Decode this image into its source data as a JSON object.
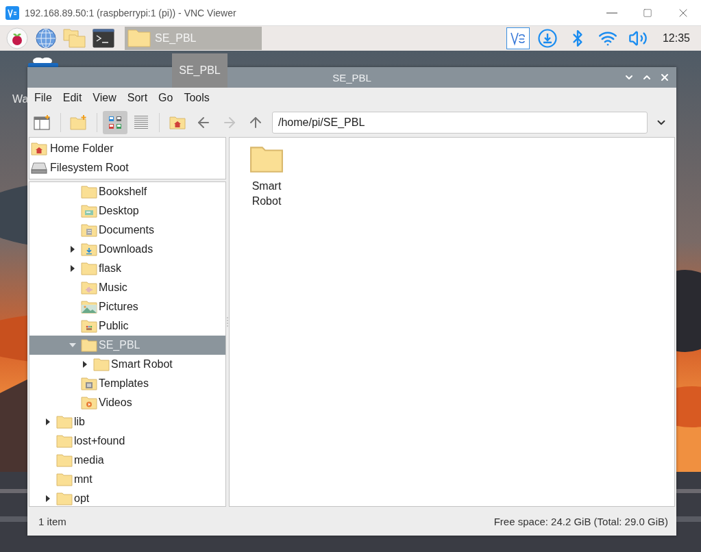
{
  "viewer_window": {
    "title": "192.168.89.50:1 (raspberrypi:1 (pi)) - VNC Viewer"
  },
  "taskbar": {
    "task_button": {
      "label": "SE_PBL"
    },
    "clock": "12:35"
  },
  "desktop": {
    "icon_label": "Wa",
    "tooltip": "SE_PBL"
  },
  "file_manager": {
    "title": "SE_PBL",
    "menu": [
      "File",
      "Edit",
      "View",
      "Sort",
      "Go",
      "Tools"
    ],
    "view_modes": [
      {
        "kind": "icons",
        "selected": true
      },
      {
        "kind": "list",
        "selected": false
      }
    ],
    "nav": [
      {
        "kind": "back",
        "disabled": false
      },
      {
        "kind": "forward",
        "disabled": true
      },
      {
        "kind": "up",
        "disabled": false
      }
    ],
    "path": "/home/pi/SE_PBL",
    "places": [
      {
        "kind": "home",
        "label": "Home Folder"
      },
      {
        "kind": "drive",
        "label": "Filesystem Root"
      }
    ],
    "tree": [
      {
        "children": [
          {
            "children": [
              {
                "label": "Bookshelf",
                "selected": false
              },
              {
                "label": "Desktop",
                "kind": "desktop",
                "selected": false
              },
              {
                "label": "Documents",
                "kind": "documents",
                "selected": false
              },
              {
                "label": "Downloads",
                "kind": "downloads",
                "selected": false,
                "expanded": false
              },
              {
                "label": "flask",
                "selected": false,
                "expanded": false
              },
              {
                "label": "Music",
                "kind": "music",
                "selected": false
              },
              {
                "label": "Pictures",
                "kind": "pictures",
                "selected": false
              },
              {
                "label": "Public",
                "kind": "public",
                "selected": false
              },
              {
                "label": "SE_PBL",
                "selected": true,
                "expanded": true,
                "children": [
                  {
                    "label": "Smart Robot",
                    "selected": false,
                    "expanded": false
                  }
                ]
              },
              {
                "label": "Templates",
                "kind": "templates",
                "selected": false
              },
              {
                "label": "Videos",
                "kind": "videos",
                "selected": false
              }
            ]
          }
        ]
      },
      {
        "label": "lib",
        "selected": false,
        "expanded": false
      },
      {
        "label": "lost+found",
        "selected": false
      },
      {
        "label": "media",
        "selected": false
      },
      {
        "label": "mnt",
        "selected": false
      },
      {
        "label": "opt",
        "selected": false,
        "expanded": false
      }
    ],
    "files": [
      {
        "name": "Smart\nRobot"
      }
    ],
    "status": {
      "count": "1 item",
      "space": "Free space: 24.2 GiB (Total: 29.0 GiB)"
    }
  }
}
